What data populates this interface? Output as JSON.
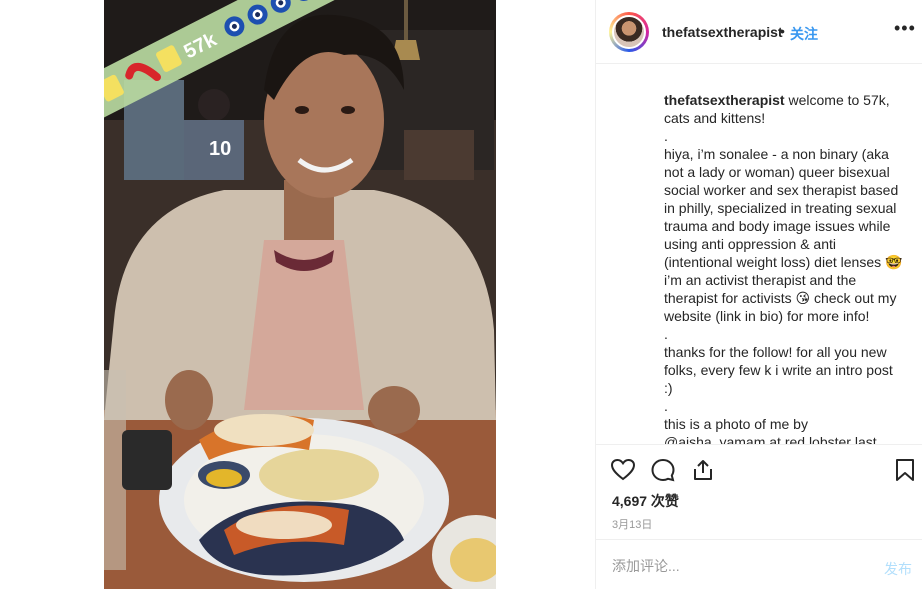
{
  "post": {
    "username": "thefatsextherapist",
    "separator": "•",
    "follow_label": "关注",
    "more_label": "•••",
    "overlay_text": "57k",
    "caption": {
      "username": "thefatsextherapist",
      "first": "welcome to 57k, cats and kittens!",
      "dot1": ".",
      "para1": "hiya, i’m sonalee - a non binary (aka not a lady or woman) queer bisexual social worker and sex therapist based in philly, specialized in treating sexual trauma and body image issues while using anti oppression & anti (intentional weight loss) diet lenses 🤓 i’m an activist therapist and the therapist for activists 😘 check out my website (link in bio) for more info!",
      "dot2": ".",
      "para2": "thanks for the follow! for all you new folks, every few k i write an intro post :)",
      "dot3": ".",
      "para3": "this is a photo of me by @aisha_yamam at red lobster last"
    },
    "likes": "4,697 次赞",
    "date": "3月13日",
    "comment_placeholder": "添加评论...",
    "post_label": "发布"
  }
}
